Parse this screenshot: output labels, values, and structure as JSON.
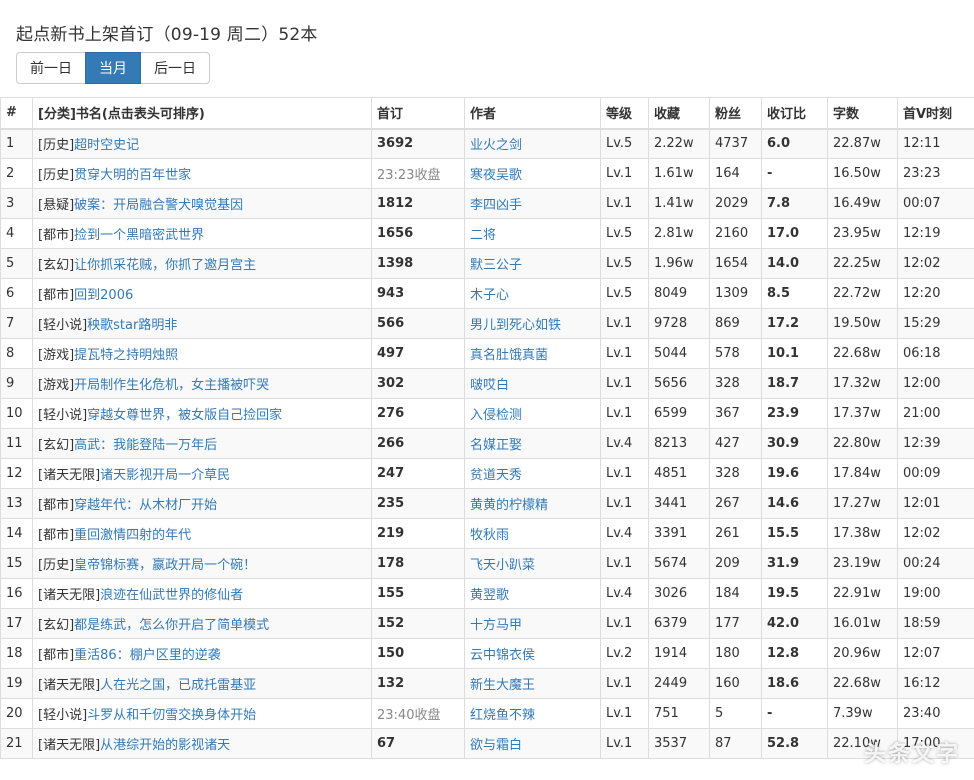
{
  "page": {
    "title": "起点新书上架首订（09-19 周二）52本",
    "buttons": {
      "prev": "前一日",
      "current": "当月",
      "next": "后一日"
    },
    "accent_color": "#337ab7"
  },
  "table": {
    "headers": [
      "#",
      "[分类]书名(点击表头可排序)",
      "首订",
      "作者",
      "等级",
      "收藏",
      "粉丝",
      "收订比",
      "字数",
      "首V时刻"
    ],
    "rows": [
      {
        "idx": "1",
        "cat": "[历史]",
        "book": "超时空史记",
        "first": "3692",
        "author": "业火之剑",
        "level": "Lv.5",
        "fav": "2.22w",
        "fans": "4737",
        "ratio": "6.0",
        "words": "22.87w",
        "time": "12:11"
      },
      {
        "idx": "2",
        "cat": "[历史]",
        "book": "贯穿大明的百年世家",
        "first": "23:23收盘",
        "author": "寒夜吴歌",
        "level": "Lv.1",
        "fav": "1.61w",
        "fans": "164",
        "ratio": "-",
        "words": "16.50w",
        "time": "23:23"
      },
      {
        "idx": "3",
        "cat": "[悬疑]",
        "book": "破案：开局融合警犬嗅觉基因",
        "first": "1812",
        "author": "李四凶手",
        "level": "Lv.1",
        "fav": "1.41w",
        "fans": "2029",
        "ratio": "7.8",
        "words": "16.49w",
        "time": "00:07"
      },
      {
        "idx": "4",
        "cat": "[都市]",
        "book": "捡到一个黑暗密武世界",
        "first": "1656",
        "author": "二将",
        "level": "Lv.5",
        "fav": "2.81w",
        "fans": "2160",
        "ratio": "17.0",
        "words": "23.95w",
        "time": "12:19"
      },
      {
        "idx": "5",
        "cat": "[玄幻]",
        "book": "让你抓采花贼，你抓了邀月宫主",
        "first": "1398",
        "author": "默三公子",
        "level": "Lv.5",
        "fav": "1.96w",
        "fans": "1654",
        "ratio": "14.0",
        "words": "22.25w",
        "time": "12:02"
      },
      {
        "idx": "6",
        "cat": "[都市]",
        "book": "回到2006",
        "first": "943",
        "author": "木子心",
        "level": "Lv.5",
        "fav": "8049",
        "fans": "1309",
        "ratio": "8.5",
        "words": "22.72w",
        "time": "12:20"
      },
      {
        "idx": "7",
        "cat": "[轻小说]",
        "book": "秧歌star路明非",
        "first": "566",
        "author": "男儿到死心如铁",
        "level": "Lv.1",
        "fav": "9728",
        "fans": "869",
        "ratio": "17.2",
        "words": "19.50w",
        "time": "15:29"
      },
      {
        "idx": "8",
        "cat": "[游戏]",
        "book": "提瓦特之持明烛照",
        "first": "497",
        "author": "真名肚饿真菌",
        "level": "Lv.1",
        "fav": "5044",
        "fans": "578",
        "ratio": "10.1",
        "words": "22.68w",
        "time": "06:18"
      },
      {
        "idx": "9",
        "cat": "[游戏]",
        "book": "开局制作生化危机，女主播被吓哭",
        "first": "302",
        "author": "啵哎白",
        "level": "Lv.1",
        "fav": "5656",
        "fans": "328",
        "ratio": "18.7",
        "words": "17.32w",
        "time": "12:00"
      },
      {
        "idx": "10",
        "cat": "[轻小说]",
        "book": "穿越女尊世界，被女版自己捡回家",
        "first": "276",
        "author": "入侵检测",
        "level": "Lv.1",
        "fav": "6599",
        "fans": "367",
        "ratio": "23.9",
        "words": "17.37w",
        "time": "21:00"
      },
      {
        "idx": "11",
        "cat": "[玄幻]",
        "book": "高武：我能登陆一万年后",
        "first": "266",
        "author": "名媒正娶",
        "level": "Lv.4",
        "fav": "8213",
        "fans": "427",
        "ratio": "30.9",
        "words": "22.80w",
        "time": "12:39"
      },
      {
        "idx": "12",
        "cat": "[诸天无限]",
        "book": "诸天影视开局一介草民",
        "first": "247",
        "author": "贫道天秀",
        "level": "Lv.1",
        "fav": "4851",
        "fans": "328",
        "ratio": "19.6",
        "words": "17.84w",
        "time": "00:09"
      },
      {
        "idx": "13",
        "cat": "[都市]",
        "book": "穿越年代：从木材厂开始",
        "first": "235",
        "author": "黄黄的柠檬精",
        "level": "Lv.1",
        "fav": "3441",
        "fans": "267",
        "ratio": "14.6",
        "words": "17.27w",
        "time": "12:01"
      },
      {
        "idx": "14",
        "cat": "[都市]",
        "book": "重回激情四射的年代",
        "first": "219",
        "author": "牧秋雨",
        "level": "Lv.4",
        "fav": "3391",
        "fans": "261",
        "ratio": "15.5",
        "words": "17.38w",
        "time": "12:02"
      },
      {
        "idx": "15",
        "cat": "[历史]",
        "book": "皇帝锦标赛，嬴政开局一个碗！",
        "first": "178",
        "author": "飞天小趴菜",
        "level": "Lv.1",
        "fav": "5674",
        "fans": "209",
        "ratio": "31.9",
        "words": "23.19w",
        "time": "00:24"
      },
      {
        "idx": "16",
        "cat": "[诸天无限]",
        "book": "浪迹在仙武世界的修仙者",
        "first": "155",
        "author": "黄翌歌",
        "level": "Lv.4",
        "fav": "3026",
        "fans": "184",
        "ratio": "19.5",
        "words": "22.91w",
        "time": "19:00"
      },
      {
        "idx": "17",
        "cat": "[玄幻]",
        "book": "都是练武，怎么你开启了简单模式",
        "first": "152",
        "author": "十方马甲",
        "level": "Lv.1",
        "fav": "6379",
        "fans": "177",
        "ratio": "42.0",
        "words": "16.01w",
        "time": "18:59"
      },
      {
        "idx": "18",
        "cat": "[都市]",
        "book": "重活86：棚户区里的逆袭",
        "first": "150",
        "author": "云中锦衣侯",
        "level": "Lv.2",
        "fav": "1914",
        "fans": "180",
        "ratio": "12.8",
        "words": "20.96w",
        "time": "12:07"
      },
      {
        "idx": "19",
        "cat": "[诸天无限]",
        "book": "人在光之国，已成托雷基亚",
        "first": "132",
        "author": "新生大魔王",
        "level": "Lv.1",
        "fav": "2449",
        "fans": "160",
        "ratio": "18.6",
        "words": "22.68w",
        "time": "16:12"
      },
      {
        "idx": "20",
        "cat": "[轻小说]",
        "book": "斗罗从和千仞雪交换身体开始",
        "first": "23:40收盘",
        "author": "红烧鱼不辣",
        "level": "Lv.1",
        "fav": "751",
        "fans": "5",
        "ratio": "-",
        "words": "7.39w",
        "time": "23:40"
      },
      {
        "idx": "21",
        "cat": "[诸天无限]",
        "book": "从港综开始的影视诸天",
        "first": "67",
        "author": "欲与霜白",
        "level": "Lv.1",
        "fav": "3537",
        "fans": "87",
        "ratio": "52.8",
        "words": "22.10w",
        "time": "17:00"
      }
    ]
  },
  "watermark": "头条文字"
}
